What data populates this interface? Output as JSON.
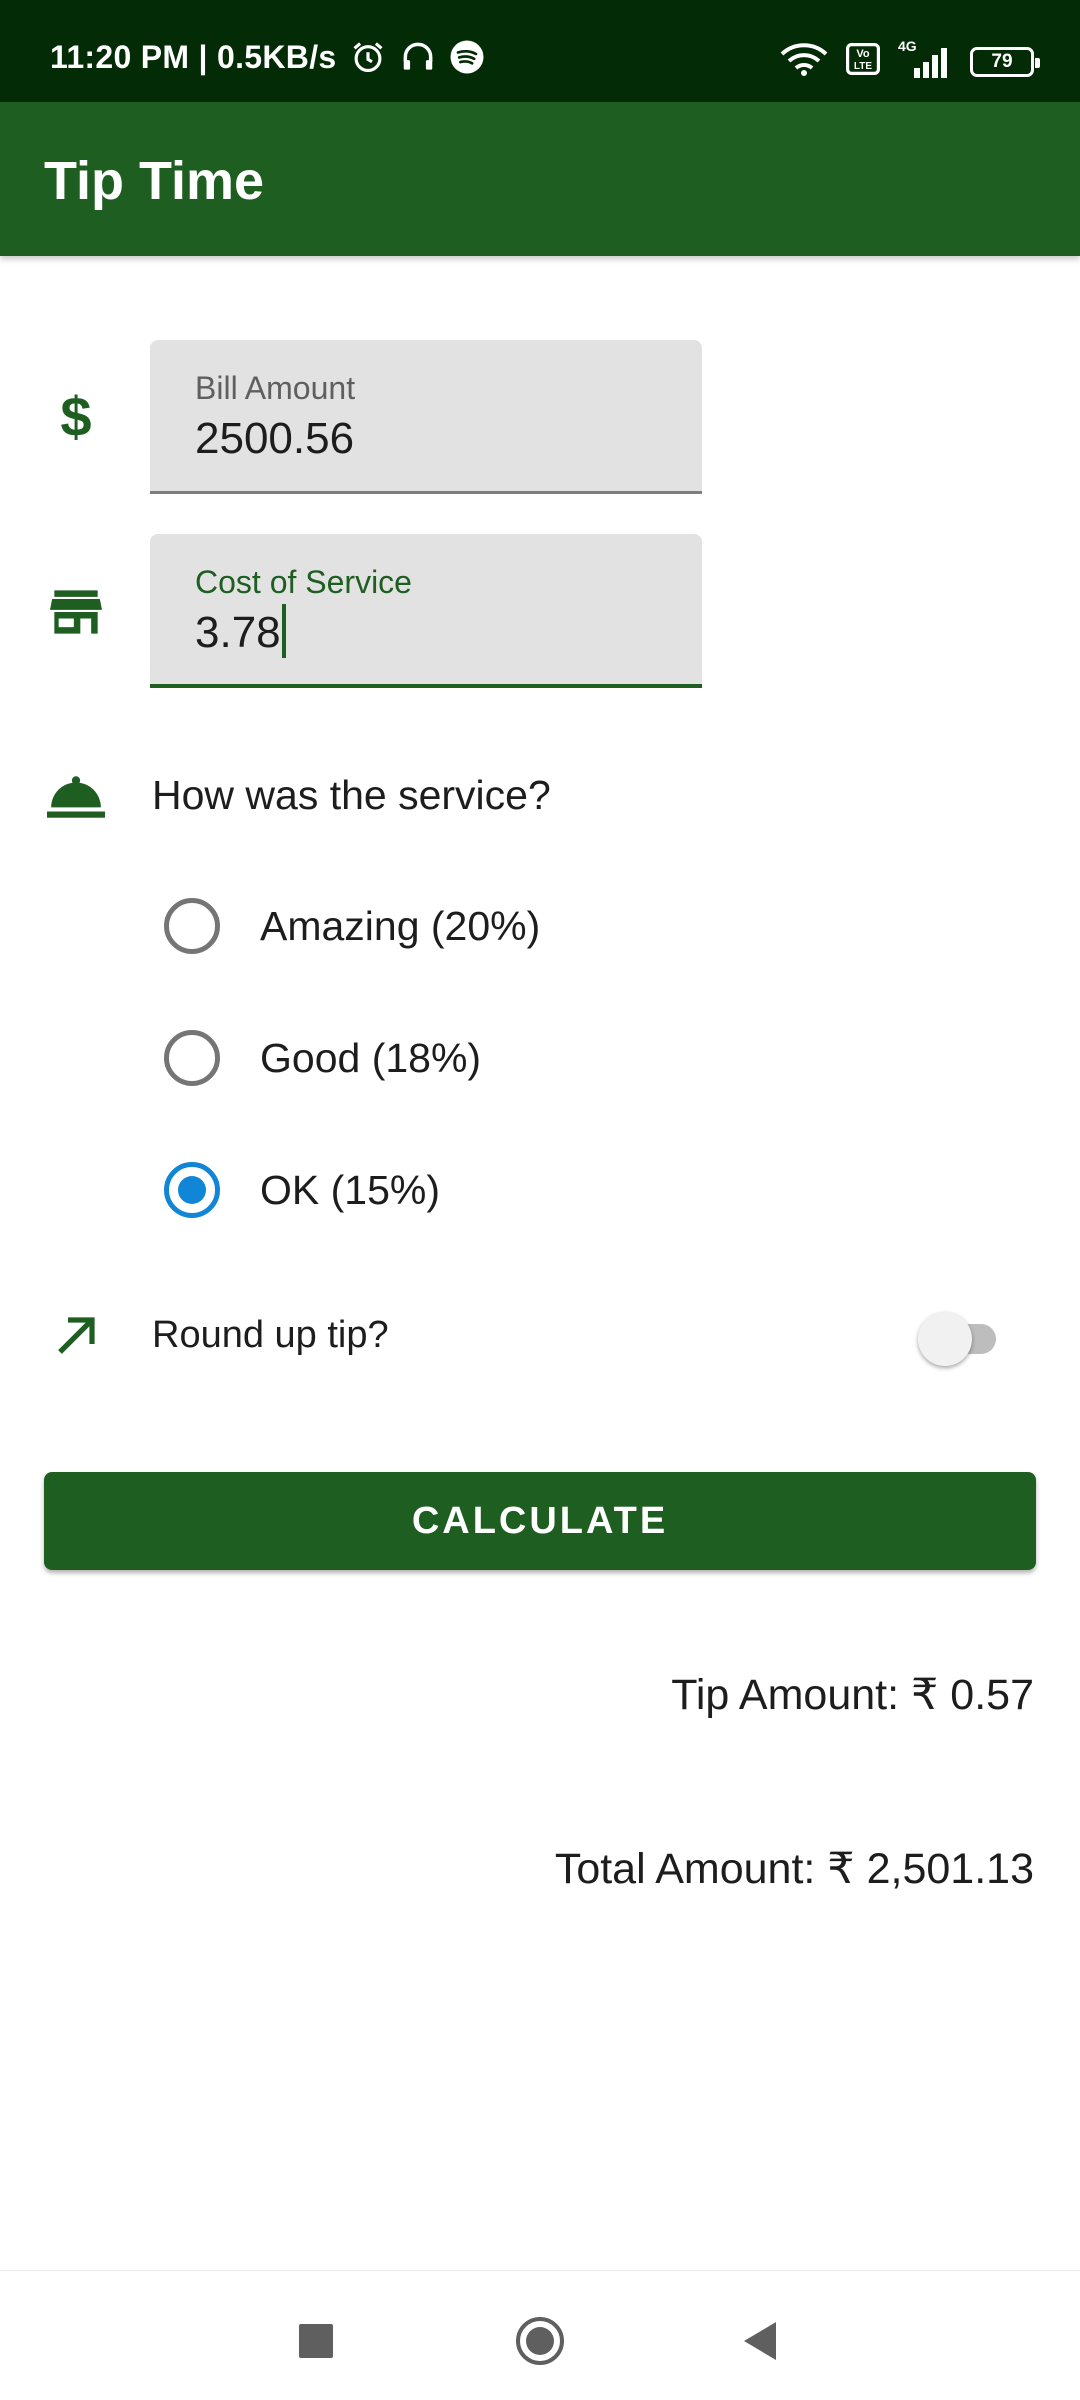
{
  "status_bar": {
    "time_speed": "11:20 PM | 0.5KB/s",
    "network_label": "4G",
    "battery": "79"
  },
  "app_bar": {
    "title": "Tip Time"
  },
  "bill_amount": {
    "label": "Bill Amount",
    "value": "2500.56"
  },
  "cost_of_service": {
    "label": "Cost of Service",
    "value": "3.78"
  },
  "service_question": "How was the service?",
  "tip_options": [
    {
      "label": "Amazing (20%)",
      "checked": false
    },
    {
      "label": "Good (18%)",
      "checked": false
    },
    {
      "label": "OK (15%)",
      "checked": true
    }
  ],
  "round_up": {
    "label": "Round up tip?",
    "enabled": false
  },
  "calculate_button": "CALCULATE",
  "results": {
    "tip": "Tip Amount: ₹ 0.57",
    "total": "Total Amount: ₹ 2,501.13"
  },
  "colors": {
    "status_bar": "#032b05",
    "primary": "#1f5e21",
    "radio_selected": "#1185d6"
  }
}
